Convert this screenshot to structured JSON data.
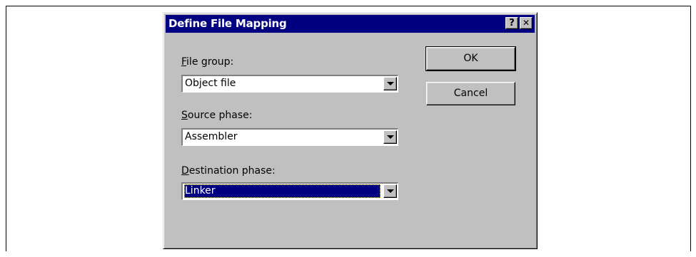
{
  "dialog": {
    "title": "Define File Mapping",
    "help_button": "?",
    "close_button": "✕"
  },
  "fields": {
    "file_group": {
      "label_hotkey": "F",
      "label_rest": "ile group:",
      "value": "Object file"
    },
    "source_phase": {
      "label_hotkey": "S",
      "label_rest": "ource phase:",
      "value": "Assembler"
    },
    "destination_phase": {
      "label_hotkey": "D",
      "label_rest": "estination phase:",
      "value": "Linker"
    }
  },
  "buttons": {
    "ok": "OK",
    "cancel": "Cancel"
  },
  "colors": {
    "title_bar": "#000080",
    "dialog_face": "#c0c0c0",
    "selection": "#000080"
  }
}
